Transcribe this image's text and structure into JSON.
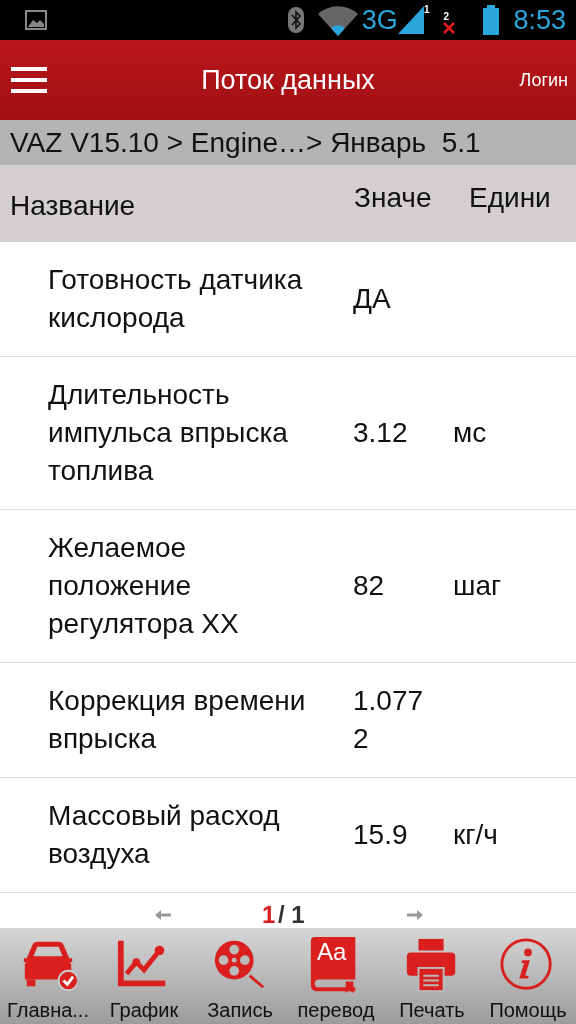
{
  "status_bar": {
    "network": "3G",
    "sim_1": "1",
    "sim_2": "2",
    "time": "8:53"
  },
  "header": {
    "title": "Поток данных",
    "login": "Логин"
  },
  "breadcrumb": "VAZ V15.10 > Engine…> Январь  5.1",
  "table": {
    "columns": [
      "Название",
      "Значе",
      "Едини"
    ],
    "rows": [
      {
        "name": "Готовность датчика кислорода",
        "value": "ДА"
      },
      {
        "name": "Длительность импульса впрыска топлива",
        "value": "3.12",
        "unit": "мс"
      },
      {
        "name": "Желаемое положение регулятора XX",
        "value": "82",
        "unit": "шаг"
      },
      {
        "name": "Коррекция времени впрыска",
        "value": "1.0772"
      },
      {
        "name": "Массовый расход воздуха",
        "value": "15.9",
        "unit": "кг/ч"
      }
    ]
  },
  "pager": {
    "current": "1",
    "total": "/ 1"
  },
  "toolbar": [
    {
      "kind": "car",
      "label": "Главна..."
    },
    {
      "kind": "graph",
      "label": "График"
    },
    {
      "kind": "record",
      "label": "Запись"
    },
    {
      "kind": "translate",
      "label": "перевод",
      "icon_text": "Aa"
    },
    {
      "kind": "print",
      "label": "Печать"
    },
    {
      "kind": "help",
      "label": "Помощь"
    }
  ]
}
